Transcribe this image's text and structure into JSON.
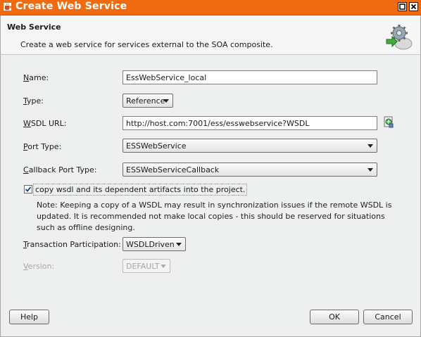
{
  "window": {
    "title": "Create Web Service"
  },
  "header": {
    "title": "Web Service",
    "description": "Create a web service for services external to the SOA composite."
  },
  "form": {
    "name": {
      "label_key": "N",
      "label_rest": "ame:",
      "value": "EssWebService_local"
    },
    "type": {
      "label_key": "T",
      "label_rest": "ype:",
      "value": "Reference"
    },
    "wsdl_url": {
      "label_key": "W",
      "label_rest": "SDL URL:",
      "value": "http://host.com:7001/ess/esswebservice?WSDL"
    },
    "port_type": {
      "label_key": "P",
      "label_rest": "ort Type:",
      "value": "ESSWebService"
    },
    "callback_port_type": {
      "label_key": "C",
      "label_rest": "allback Port Type:",
      "value": "ESSWebServiceCallback"
    },
    "copy_wsdl": {
      "checked": true,
      "label": "copy wsdl and its dependent artifacts into the project."
    },
    "note": "Note: Keeping a copy of a WSDL may result in synchronization issues if the remote WSDL is updated. It is recommended not make local copies - this should be reserved for situations such as offline designing.",
    "transaction": {
      "label_key": "T",
      "label_rest": "ransaction Participation:",
      "value": "WSDLDriven"
    },
    "version": {
      "label_key": "V",
      "label_rest": "ersion:",
      "value": "DEFAULT"
    }
  },
  "buttons": {
    "help": "Help",
    "ok": "OK",
    "cancel": "Cancel"
  },
  "icons": {
    "title": "java-cup-icon",
    "wizard": "web-service-gear-icon",
    "browse": "browse-wsdl-icon"
  },
  "colors": {
    "titlebar": "#f06a10",
    "focus_border": "#e07b1a"
  }
}
